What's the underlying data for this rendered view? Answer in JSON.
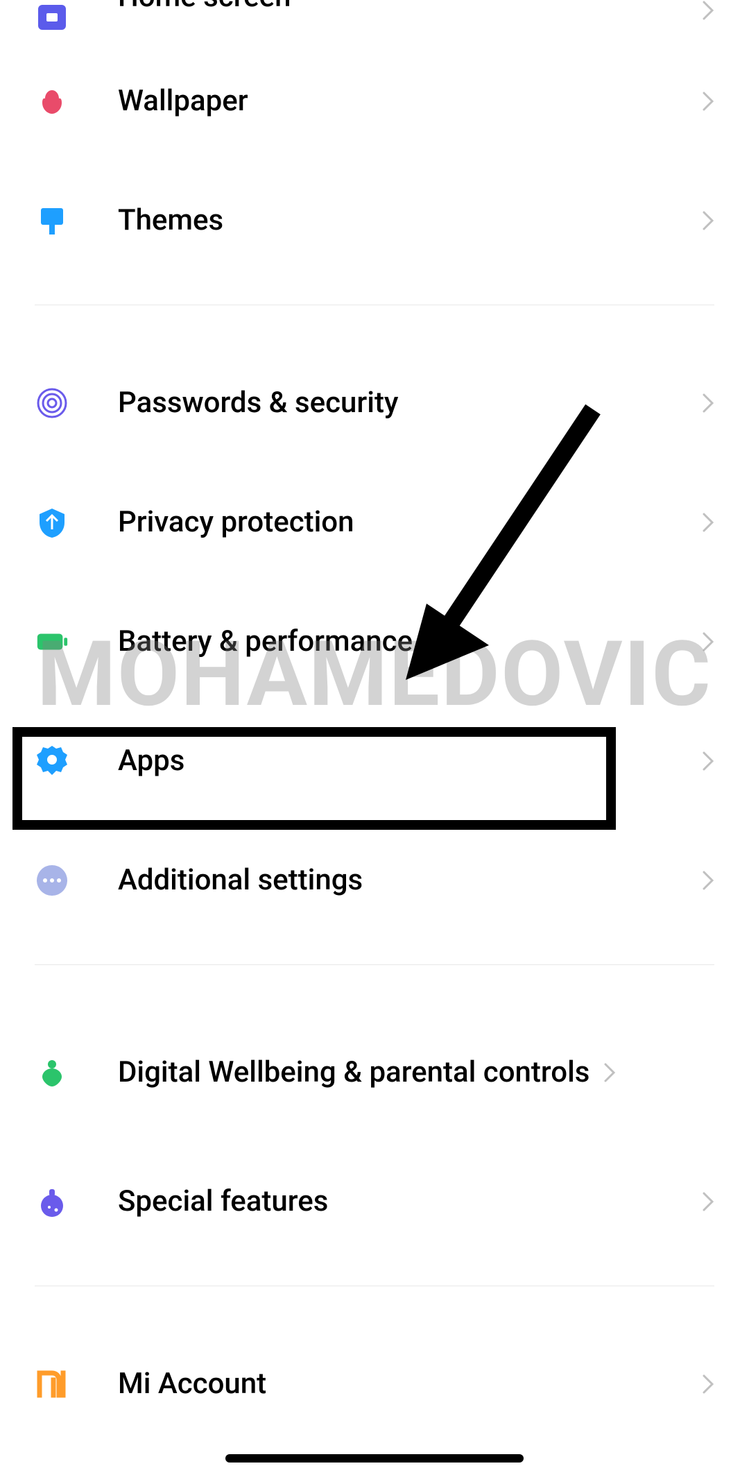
{
  "settings": {
    "groups": [
      {
        "items": [
          {
            "key": "home-screen",
            "label": "Home screen",
            "iconColor": "#5B5BEB",
            "partial": true
          },
          {
            "key": "wallpaper",
            "label": "Wallpaper",
            "iconColor": "#E94B6A"
          },
          {
            "key": "themes",
            "label": "Themes",
            "iconColor": "#1E9FFF"
          }
        ]
      },
      {
        "items": [
          {
            "key": "passwords-security",
            "label": "Passwords & security",
            "iconColor": "#6A5BEB"
          },
          {
            "key": "privacy-protection",
            "label": "Privacy protection",
            "iconColor": "#1E9FFF"
          },
          {
            "key": "battery-performance",
            "label": "Battery & performance",
            "iconColor": "#2BC46B"
          },
          {
            "key": "apps",
            "label": "Apps",
            "iconColor": "#1E9FFF",
            "highlighted": true
          },
          {
            "key": "additional-settings",
            "label": "Additional settings",
            "iconColor": "#A8B4E8"
          }
        ]
      },
      {
        "items": [
          {
            "key": "digital-wellbeing",
            "label": "Digital Wellbeing & parental controls",
            "iconColor": "#2BC46B",
            "multiline": true
          },
          {
            "key": "special-features",
            "label": "Special features",
            "iconColor": "#6A5BEB"
          }
        ]
      },
      {
        "items": [
          {
            "key": "mi-account",
            "label": "Mi Account",
            "iconColor": "#FF9C2A"
          }
        ]
      }
    ]
  },
  "watermark": "MOHAMEDOVIC"
}
